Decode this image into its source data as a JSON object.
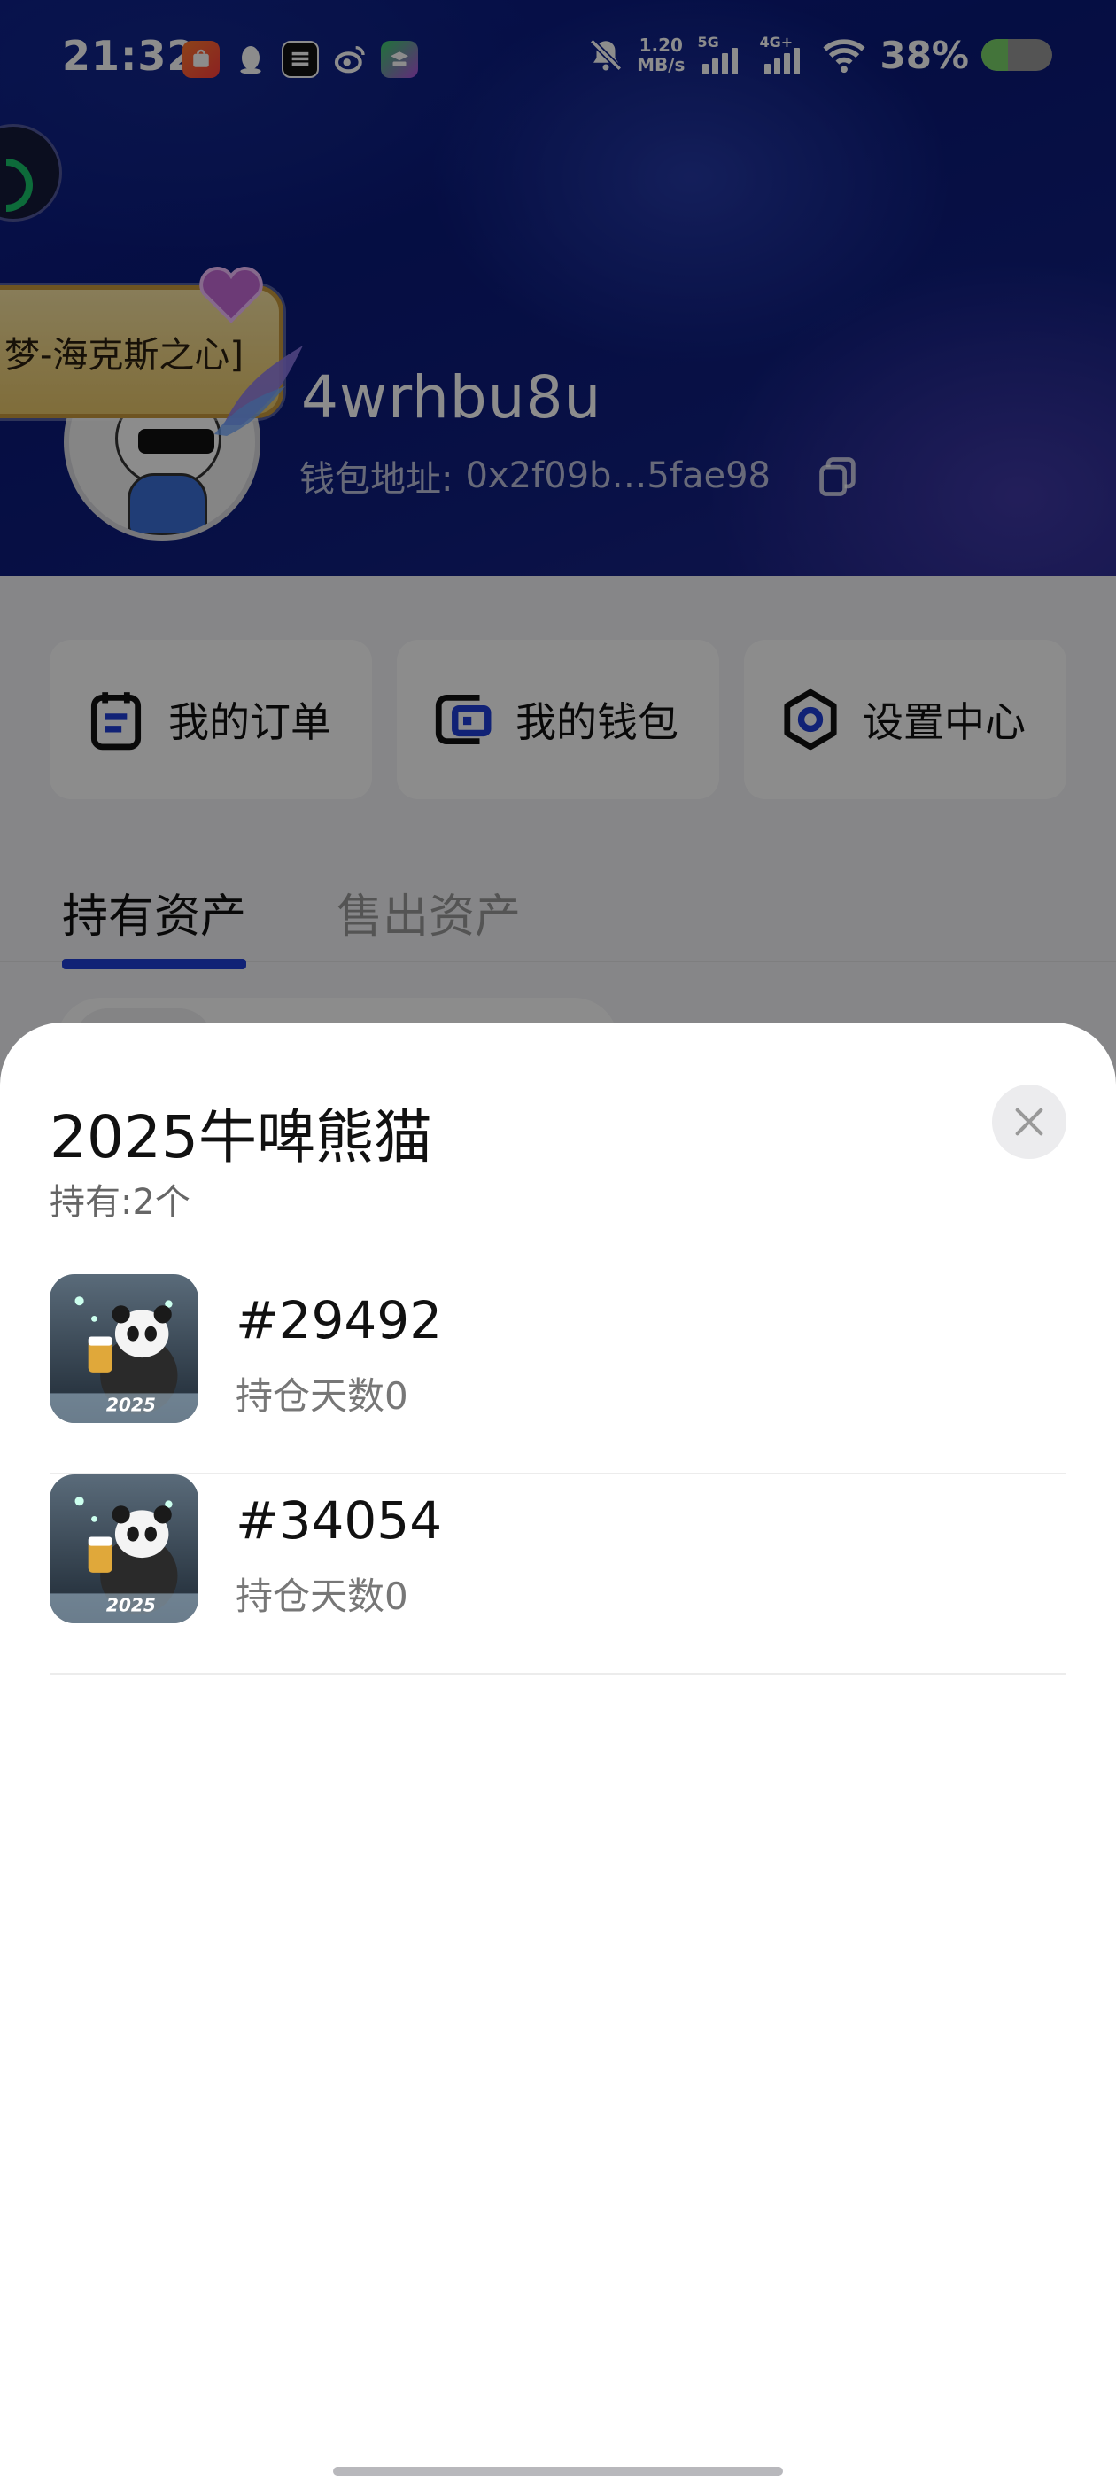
{
  "status_bar": {
    "time": "21:32",
    "net_speed_value": "1.20",
    "net_speed_unit": "MB/s",
    "signal1_label": "5G",
    "signal2_label": "4G+",
    "battery_percent": "38%",
    "battery_level": 0.38
  },
  "profile": {
    "title_badge": "梦-海克斯之心]",
    "username": "4wrhbu8u",
    "wallet_label": "钱包地址:",
    "wallet_address": "0x2f09b…5fae98"
  },
  "quick_actions": [
    {
      "label": "我的订单",
      "icon": "clipboard-icon"
    },
    {
      "label": "我的钱包",
      "icon": "wallet-icon"
    },
    {
      "label": "设置中心",
      "icon": "settings-hexagon-icon"
    }
  ],
  "tabs": {
    "held": "持有资产",
    "sold": "售出资产"
  },
  "sheet": {
    "title": "2025牛啤熊猫",
    "holding": "持有:2个",
    "items": [
      {
        "id": "#29492",
        "days": "持仓天数0"
      },
      {
        "id": "#34054",
        "days": "持仓天数0"
      }
    ]
  },
  "colors": {
    "accent": "#1f3fd8",
    "header_bg": "#0c1f8a",
    "battery_fill": "#7bd36b"
  }
}
